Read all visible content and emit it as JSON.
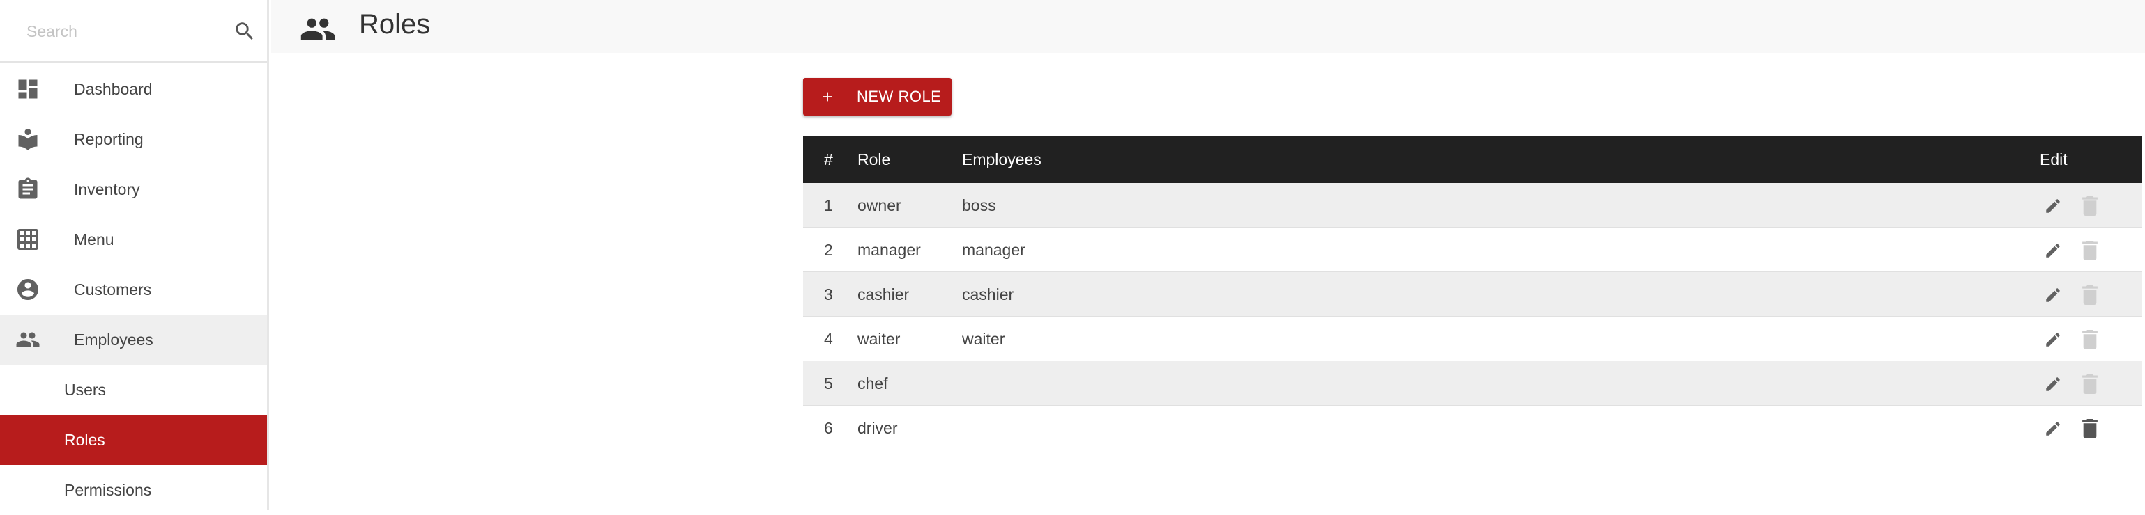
{
  "search": {
    "placeholder": "Search"
  },
  "sidebar": {
    "items": [
      {
        "label": "Dashboard",
        "icon": "dashboard-icon"
      },
      {
        "label": "Reporting",
        "icon": "reporting-icon"
      },
      {
        "label": "Inventory",
        "icon": "clipboard-icon"
      },
      {
        "label": "Menu",
        "icon": "grid-icon"
      },
      {
        "label": "Customers",
        "icon": "account-circle-icon"
      },
      {
        "label": "Employees",
        "icon": "people-icon"
      }
    ],
    "subitems": [
      {
        "label": "Users"
      },
      {
        "label": "Roles",
        "selected": true
      },
      {
        "label": "Permissions"
      }
    ]
  },
  "header": {
    "title": "Roles",
    "icon": "people-icon"
  },
  "toolbar": {
    "new_role_label": "NEW ROLE"
  },
  "table": {
    "headers": {
      "num": "#",
      "role": "Role",
      "employees": "Employees",
      "edit": "Edit"
    },
    "rows": [
      {
        "num": "1",
        "role": "owner",
        "employees": "boss",
        "delete_enabled": false
      },
      {
        "num": "2",
        "role": "manager",
        "employees": "manager",
        "delete_enabled": false
      },
      {
        "num": "3",
        "role": "cashier",
        "employees": "cashier",
        "delete_enabled": false
      },
      {
        "num": "4",
        "role": "waiter",
        "employees": "waiter",
        "delete_enabled": false
      },
      {
        "num": "5",
        "role": "chef",
        "employees": "",
        "delete_enabled": false
      },
      {
        "num": "6",
        "role": "driver",
        "employees": "",
        "delete_enabled": true
      }
    ]
  },
  "colors": {
    "accent": "#b71c1c",
    "table_header": "#212121",
    "row_stripe": "#eeeeee",
    "icon": "#616161",
    "icon_disabled": "#cfcfcf"
  }
}
